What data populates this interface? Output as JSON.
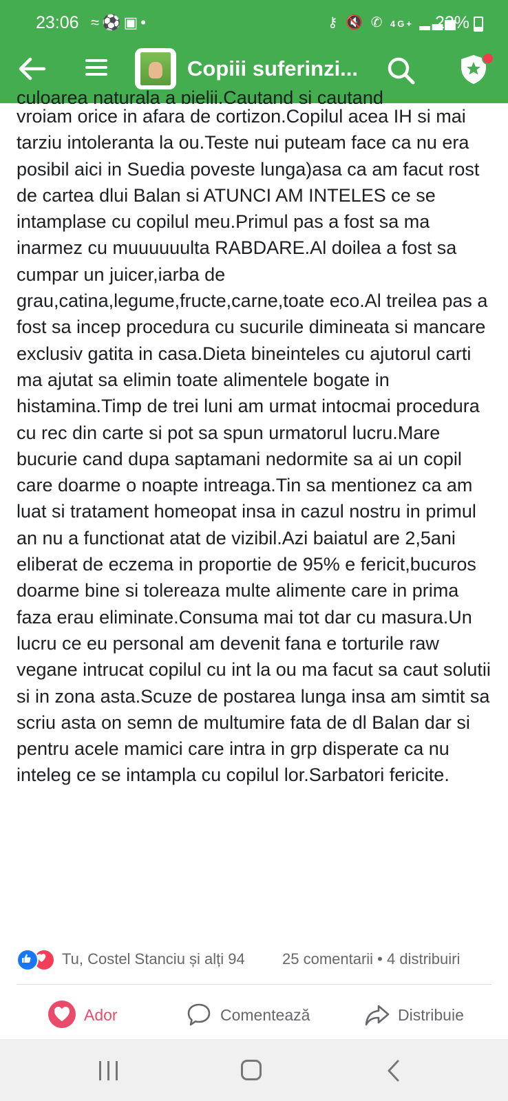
{
  "status_bar": {
    "time": "23:06",
    "battery": "22%",
    "network": "4G+"
  },
  "header": {
    "title": "Copiii suferinzi...",
    "accent_color": "#44ad4f"
  },
  "post": {
    "partial_first_line": "culoarea naturala a pielii.Cautand si cautand",
    "text": "vroiam orice in afara de cortizon.Copilul acea IH si mai tarziu intoleranta la ou.Teste nui puteam face ca nu era posibil aici in Suedia poveste lunga)asa ca am facut rost de cartea dlui Balan  si ATUNCI AM INTELES ce se intamplase cu copilul meu.Primul pas a fost sa ma inarmez cu muuuuuulta RABDARE.Al doilea a fost sa cumpar un juicer,iarba de grau,catina,legume,fructe,carne,toate eco.Al treilea pas a fost sa incep procedura cu sucurile dimineata si mancare exclusiv gatita in casa.Dieta bineinteles cu ajutorul carti ma ajutat sa elimin toate alimentele bogate in histamina.Timp de trei luni am urmat intocmai procedura cu rec din carte si pot sa spun urmatorul lucru.Mare bucurie cand dupa saptamani nedormite sa ai un copil care doarme o noapte intreaga.Tin sa mentionez ca am luat si tratament homeopat insa in cazul nostru in primul an nu a functionat atat de vizibil.Azi baiatul are 2,5ani eliberat de eczema in proportie de 95% e fericit,bucuros doarme bine si tolereaza multe alimente care in prima faza erau eliminate.Consuma mai tot dar cu masura.Un lucru ce eu personal am devenit fana e torturile raw vegane intrucat copilul cu int la ou ma facut sa caut solutii si in zona asta.Scuze de postarea lunga insa am simtit sa scriu asta on semn de multumire fata de dl Balan dar si pentru acele mamici care intra in grp disperate ca nu inteleg ce se intampla cu copilul lor.Sarbatori fericite."
  },
  "stats": {
    "reactions_text": "Tu, Costel Stanciu și alți 94",
    "comments_text": "25 comentarii • 4 distribuiri"
  },
  "actions": {
    "react_label": "Ador",
    "comment_label": "Comentează",
    "share_label": "Distribuie"
  },
  "colors": {
    "love": "#e94c6b",
    "like": "#1877f2"
  }
}
